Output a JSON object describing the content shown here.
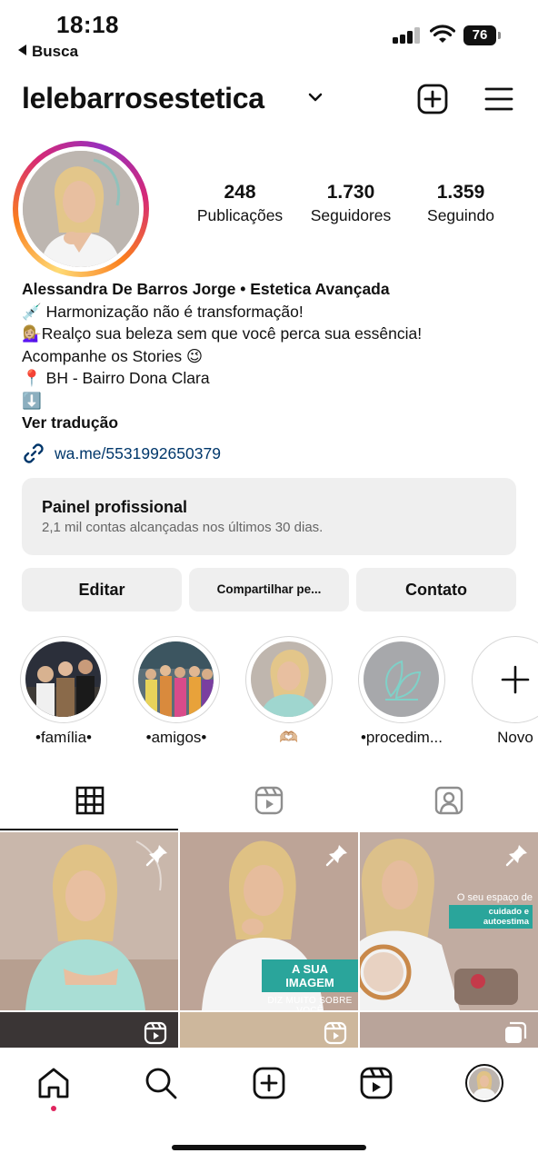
{
  "status_bar": {
    "time": "18:18",
    "back_label": "Busca",
    "battery": "76"
  },
  "header": {
    "username": "lelebarrosestetica"
  },
  "stats": [
    {
      "value": "248",
      "label": "Publicações"
    },
    {
      "value": "1.730",
      "label": "Seguidores"
    },
    {
      "value": "1.359",
      "label": "Seguindo"
    }
  ],
  "bio": {
    "name": "Alessandra De Barros Jorge • Estetica Avançada",
    "line1": "💉 Harmonização não é transformação!",
    "line2": "💁🏼‍♀️Realço sua beleza sem que você perca sua essência!",
    "line3": "Acompanhe os Stories 😉",
    "line4": "📍 BH - Bairro Dona Clara",
    "line5": "⬇️",
    "translate": "Ver tradução",
    "link": "wa.me/5531992650379"
  },
  "panel": {
    "title": "Painel profissional",
    "subtitle": "2,1 mil contas alcançadas nos últimos 30 dias."
  },
  "buttons": {
    "edit": "Editar",
    "share": "Compartilhar pe...",
    "contact": "Contato"
  },
  "highlights": [
    {
      "label": "•família•"
    },
    {
      "label": "•amigos•"
    },
    {
      "label": "🫶🏼"
    },
    {
      "label": "•procedim..."
    },
    {
      "label": "Novo"
    }
  ],
  "posts": {
    "post2_caption_main": "A SUA IMAGEM",
    "post2_caption_sub": "DIZ MUITO SOBRE VOCÊ",
    "post3_caption_line1": "O seu espaço de",
    "post3_caption_line2": "cuidado e autoestima"
  },
  "colors": {
    "link": "#00376b",
    "button_bg": "#efefef",
    "accent_teal": "#2aa59b",
    "notification_dot": "#e0245e"
  }
}
